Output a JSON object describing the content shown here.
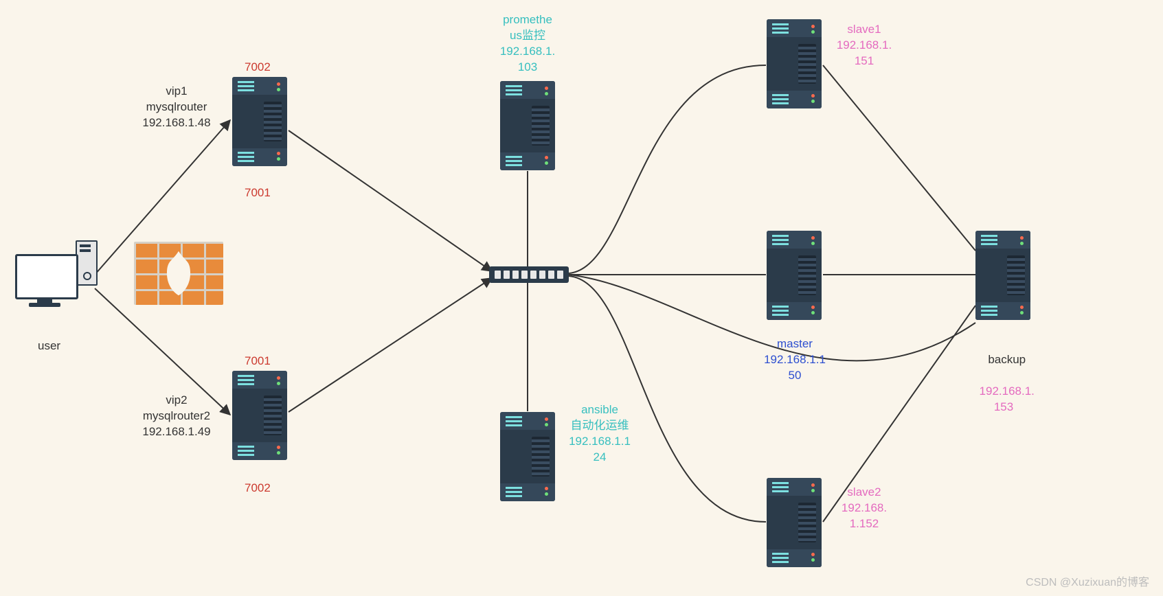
{
  "watermark": "CSDN @Xuzixuan的博客",
  "nodes": {
    "user": {
      "label": "user"
    },
    "router1": {
      "label": "vip1\nmysqlrouter\n192.168.1.48",
      "port_top": "7002",
      "port_bottom": "7001"
    },
    "router2": {
      "label": "vip2\nmysqlrouter2\n192.168.1.49",
      "port_top": "7001",
      "port_bottom": "7002"
    },
    "prometheus": {
      "label": "promethe\nus监控\n192.168.1.\n103"
    },
    "ansible": {
      "label": "ansible\n自动化运维\n192.168.1.1\n24"
    },
    "master": {
      "label": "master\n192.168.1.1\n50"
    },
    "slave1": {
      "label": "slave1\n192.168.1.\n151"
    },
    "slave2": {
      "label": "slave2\n192.168.\n1.152"
    },
    "backup": {
      "name": "backup",
      "ip": "192.168.1.\n153"
    }
  },
  "chart_data": {
    "type": "network-topology",
    "nodes": [
      {
        "id": "user",
        "kind": "workstation",
        "label": "user"
      },
      {
        "id": "firewall",
        "kind": "firewall"
      },
      {
        "id": "router1",
        "kind": "server",
        "label": "vip1 mysqlrouter",
        "ip": "192.168.1.48",
        "ports": [
          7002,
          7001
        ]
      },
      {
        "id": "router2",
        "kind": "server",
        "label": "vip2 mysqlrouter2",
        "ip": "192.168.1.49",
        "ports": [
          7001,
          7002
        ]
      },
      {
        "id": "switch",
        "kind": "switch"
      },
      {
        "id": "prometheus",
        "kind": "server",
        "label": "prometheus监控",
        "ip": "192.168.1.103"
      },
      {
        "id": "ansible",
        "kind": "server",
        "label": "ansible 自动化运维",
        "ip": "192.168.1.124"
      },
      {
        "id": "master",
        "kind": "server",
        "label": "master",
        "ip": "192.168.1.150"
      },
      {
        "id": "slave1",
        "kind": "server",
        "label": "slave1",
        "ip": "192.168.1.151"
      },
      {
        "id": "slave2",
        "kind": "server",
        "label": "slave2",
        "ip": "192.168.1.152"
      },
      {
        "id": "backup",
        "kind": "server",
        "label": "backup",
        "ip": "192.168.1.153"
      }
    ],
    "edges": [
      {
        "from": "user",
        "to": "router1",
        "directed": true
      },
      {
        "from": "user",
        "to": "router2",
        "directed": true
      },
      {
        "from": "router1",
        "to": "switch",
        "directed": true
      },
      {
        "from": "router2",
        "to": "switch",
        "directed": true
      },
      {
        "from": "switch",
        "to": "prometheus"
      },
      {
        "from": "switch",
        "to": "ansible"
      },
      {
        "from": "switch",
        "to": "master"
      },
      {
        "from": "switch",
        "to": "slave1"
      },
      {
        "from": "switch",
        "to": "slave2"
      },
      {
        "from": "switch",
        "to": "backup"
      },
      {
        "from": "master",
        "to": "backup"
      },
      {
        "from": "slave1",
        "to": "backup"
      },
      {
        "from": "slave2",
        "to": "backup"
      }
    ]
  }
}
